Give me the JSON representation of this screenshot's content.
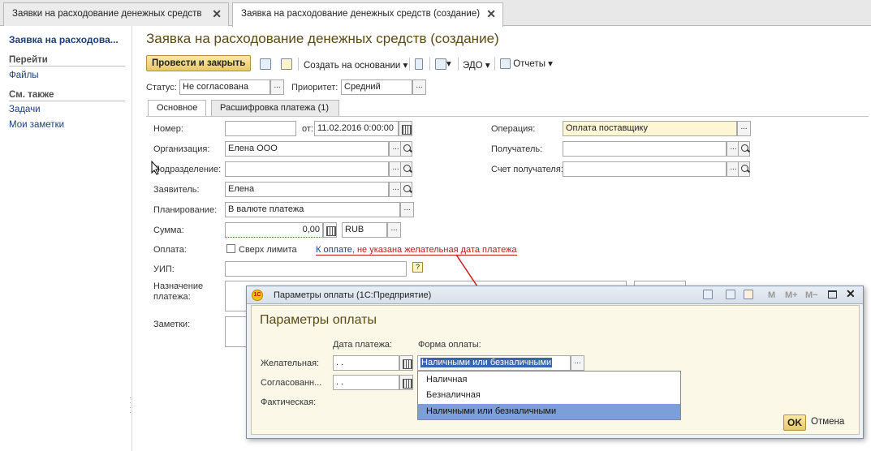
{
  "tabs": [
    {
      "label": "Заявки на расходование денежных средств",
      "close": "✕"
    },
    {
      "label": "Заявка на расходование денежных средств (создание)",
      "close": "✕"
    }
  ],
  "sidebar": {
    "title": "Заявка на расходова...",
    "sections": [
      {
        "header": "Перейти",
        "items": [
          "Файлы"
        ]
      },
      {
        "header": "См. также",
        "items": [
          "Задачи",
          "Мои заметки"
        ]
      }
    ]
  },
  "form": {
    "title": "Заявка на расходование денежных средств (создание)",
    "toolbar": {
      "post_close": "Провести и закрыть",
      "create_based": "Создать на основании",
      "edo": "ЭДО",
      "reports": "Отчеты"
    },
    "status_label": "Статус:",
    "status_value": "Не согласована",
    "priority_label": "Приоритет:",
    "priority_value": "Средний",
    "inner_tabs": [
      "Основное",
      "Расшифровка платежа (1)"
    ],
    "fields": {
      "number_label": "Номер:",
      "number_value": "",
      "from_label": "от:",
      "from_value": "11.02.2016  0:00:00",
      "org_label": "Организация:",
      "org_value": "Елена ООО",
      "dept_label": "Подразделение:",
      "dept_value": "",
      "applicant_label": "Заявитель:",
      "applicant_value": "Елена",
      "planning_label": "Планирование:",
      "planning_value": "В валюте платежа",
      "sum_label": "Сумма:",
      "sum_value": "0,00",
      "currency_value": "RUB",
      "payment_label": "Оплата:",
      "over_limit_label": "Сверх лимита",
      "payment_link": "К оплате",
      "payment_warning": ", не указана желательная дата платежа",
      "uip_label": "УИП:",
      "uip_value": "",
      "purpose_label_1": "Назначение",
      "purpose_label_2": "платежа:",
      "notes_label": "Заметки:",
      "operation_label": "Операция:",
      "operation_value": "Оплата поставщику",
      "recipient_label": "Получатель:",
      "recipient_value": "",
      "account_label": "Счет получателя:",
      "account_value": ""
    }
  },
  "dialog": {
    "window_title": "Параметры оплаты  (1С:Предприятие)",
    "title_buttons": [
      "M",
      "M+",
      "M−"
    ],
    "heading": "Параметры оплаты",
    "col_date": "Дата платежа:",
    "col_form": "Форма оплаты:",
    "row_desired": "Желательная:",
    "row_agreed": "Согласованн...",
    "row_actual": "Фактическая:",
    "date_empty": " .  .",
    "form_value": "Наличными или безналичными",
    "options": [
      "Наличная",
      "Безналичная",
      "Наличными или безналичными"
    ],
    "selected_option": 2,
    "ok": "OK",
    "cancel": "Отмена"
  },
  "colors": {
    "accent_title": "#5b4a16",
    "link": "#1d3e7a",
    "warning_red": "#c01818",
    "selection": "#7b9fd6"
  }
}
